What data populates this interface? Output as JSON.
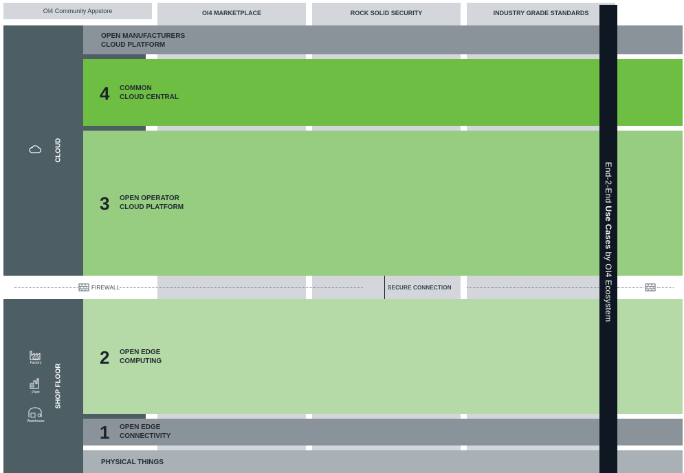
{
  "header": {
    "appstore": "OI4 Community Appstore",
    "marketplace": "OI4 MARKETPLACE",
    "security": "ROCK SOLID SECURITY",
    "standards": "INDUSTRY GRADE STANDARDS"
  },
  "zones": {
    "cloud": "CLOUD",
    "shop_floor": "SHOP FLOOR"
  },
  "bands": {
    "manufacturers": {
      "line1": "OPEN MANUFACTURERS",
      "line2": "CLOUD PLATFORM"
    },
    "layer4": {
      "num": "4",
      "line1": "COMMON",
      "line2": "CLOUD CENTRAL"
    },
    "layer3": {
      "num": "3",
      "line1": "OPEN OPERATOR",
      "line2": "CLOUD PLATFORM"
    },
    "layer2": {
      "num": "2",
      "line1": "OPEN EDGE",
      "line2": "COMPUTING"
    },
    "layer1": {
      "num": "1",
      "line1": "OPEN EDGE",
      "line2": "CONNECTIVITY"
    },
    "physical": {
      "label": "PHYSICAL THINGS"
    }
  },
  "connection": {
    "firewall": "FIREWALL",
    "secure": "SECURE CONNECTION"
  },
  "shop_icons": {
    "factory": "Factory",
    "plant": "Plant",
    "warehouse": "Warehouse"
  },
  "vertical_bar": {
    "prefix": "End-2-End ",
    "bold": "Use Cases",
    "suffix": " by OI4 Ecosystem"
  },
  "colors": {
    "layer4": "#6fbe44",
    "layer3": "#97cd80",
    "layer2": "#b6d9a8",
    "gray_band": "#8a9399",
    "physical": "#a9b1b6",
    "sidebar": "#4d5e64",
    "column": "#d3d6db",
    "vertical_bar": "#0f1822"
  }
}
